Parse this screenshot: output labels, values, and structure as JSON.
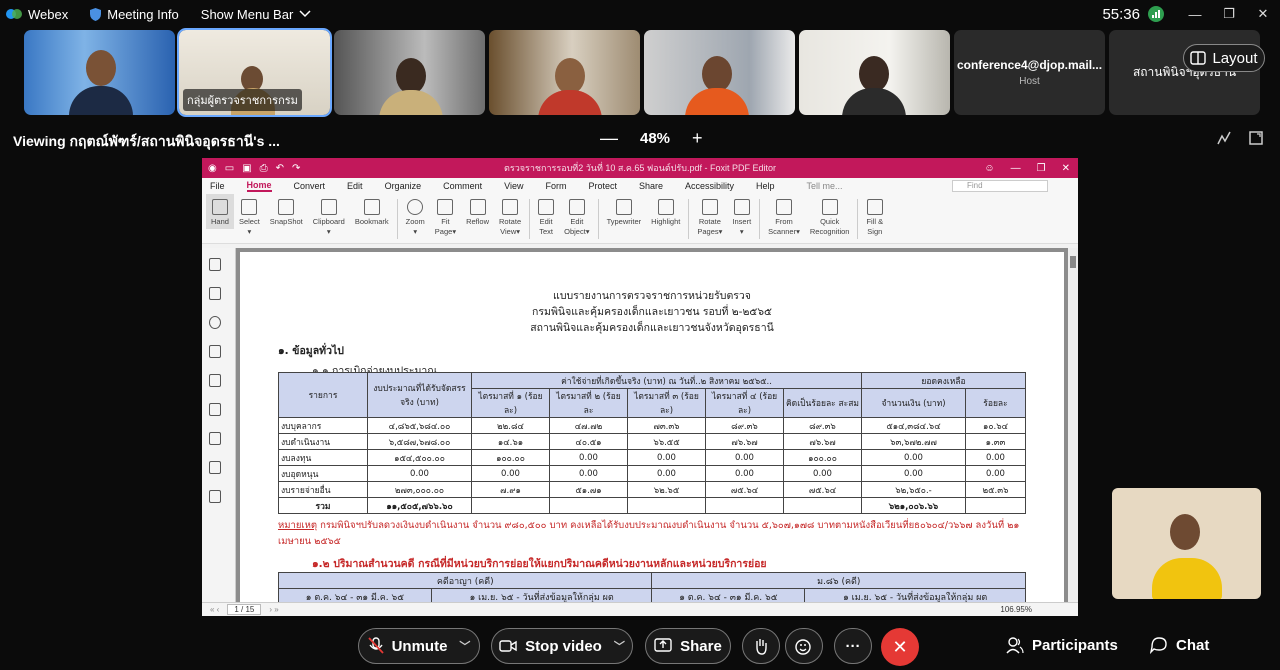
{
  "topbar": {
    "app_name": "Webex",
    "meeting_info": "Meeting Info",
    "show_menu": "Show Menu Bar",
    "timer": "55:36",
    "win_min": "—",
    "win_max": "❐",
    "win_close": "✕"
  },
  "participants_strip": {
    "tile2_label": "กลุ่มผู้ตรวจราชการกรม",
    "tile7_name": "conference4@djop.mail...",
    "tile7_role": "Host",
    "tile8_name": "สถานพินิจฯอุดรธานี"
  },
  "layout_label": "Layout",
  "viewing": {
    "text": "Viewing กฤตณ์พัฑร์/สถานพินิจอุดรธานี's ...",
    "zoom_level": "48%",
    "zoom_out": "—",
    "zoom_in": "+"
  },
  "foxit": {
    "title": "ตรวจราชการรอบที่2 วันที่ 10 ส.ค.65 ฟอนต์ปรับ.pdf - Foxit PDF Editor",
    "menu": [
      "File",
      "Home",
      "Convert",
      "Edit",
      "Organize",
      "Comment",
      "View",
      "Form",
      "Protect",
      "Share",
      "Accessibility",
      "Help"
    ],
    "tell_me": "Tell me...",
    "find": "Find",
    "ribbon": [
      {
        "l1": "Hand",
        "l2": ""
      },
      {
        "l1": "Select",
        "l2": "▾"
      },
      {
        "l1": "SnapShot",
        "l2": ""
      },
      {
        "l1": "Clipboard",
        "l2": "▾"
      },
      {
        "l1": "Bookmark",
        "l2": ""
      },
      {
        "l1": "Zoom",
        "l2": "▾"
      },
      {
        "l1": "Fit",
        "l2": "Page▾"
      },
      {
        "l1": "Reflow",
        "l2": ""
      },
      {
        "l1": "Rotate",
        "l2": "View▾"
      },
      {
        "l1": "Edit",
        "l2": "Text"
      },
      {
        "l1": "Edit",
        "l2": "Object▾"
      },
      {
        "l1": "Typewriter",
        "l2": ""
      },
      {
        "l1": "Highlight",
        "l2": ""
      },
      {
        "l1": "Rotate",
        "l2": "Pages▾"
      },
      {
        "l1": "Insert",
        "l2": "▾"
      },
      {
        "l1": "From",
        "l2": "Scanner▾"
      },
      {
        "l1": "Quick",
        "l2": "Recognition"
      },
      {
        "l1": "Fill &",
        "l2": "Sign"
      }
    ],
    "page_indicator": "1 / 15",
    "zoom": "106.95%"
  },
  "document": {
    "title1": "แบบรายงานการตรวจราชการหน่วยรับตรวจ",
    "title2": "กรมพินิจและคุ้มครองเด็กและเยาวชน รอบที่ ๒-๒๕๖๕",
    "title3": "สถานพินิจและคุ้มครองเด็กและเยาวชนจังหวัดอุดรธานี",
    "section1": "๑. ข้อมูลทั่วไป",
    "section1_1": "๑.๑ การเบิกจ่ายงบประมาณ",
    "table": {
      "h_item": "รายการ",
      "h_budget": "งบประมาณที่ได้รับจัดสรรจริง (บาท)",
      "h_spent": "ค่าใช้จ่ายที่เกิดขึ้นจริง (บาท) ณ วันที่..๒ สิงหาคม ๒๕๖๕..",
      "h_remain": "ยอดคงเหลือ",
      "h_q1": "ไตรมาสที่ ๑ (ร้อยละ)",
      "h_q2": "ไตรมาสที่ ๒ (ร้อยละ",
      "h_q3": "ไตรมาสที่ ๓ (ร้อยละ)",
      "h_q4": "ไตรมาสที่ ๔ (ร้อยละ)",
      "h_cum": "คิดเป็นร้อยละ สะสม",
      "h_amount": "จำนวนเงิน (บาท)",
      "h_pct": "ร้อยละ",
      "rows": [
        {
          "item": "งบบุคลากร",
          "budget": "๔,๘๖๕,๖๘๔.๐๐",
          "q1": "๒๒.๘๔",
          "q2": "๔๗.๗๒",
          "q3": "๗๓.๓๖",
          "q4": "๘๙.๓๖",
          "cum": "๘๙.๓๖",
          "amount": "๕๑๔,๓๘๔.๖๔",
          "pct": "๑๐.๖๔"
        },
        {
          "item": "งบดำเนินงาน",
          "budget": "๖,๕๘๗,๖๗๘.๐๐",
          "q1": "๑๔.๖๑",
          "q2": "๔๐.๕๑",
          "q3": "๖๖.๕๕",
          "q4": "๗๖.๖๗",
          "cum": "๗๖.๖๗",
          "amount": "๖๓,๖๗๒.๗๗",
          "pct": "๑.๓๓"
        },
        {
          "item": "งบลงทุน",
          "budget": "๑๕๔,๕๐๐.๐๐",
          "q1": "๑๐๐.๐๐",
          "q2": "0.00",
          "q3": "0.00",
          "q4": "0.00",
          "cum": "๑๐๐.๐๐",
          "amount": "0.00",
          "pct": "0.00"
        },
        {
          "item": "งบอุดหนุน",
          "budget": "0.00",
          "q1": "0.00",
          "q2": "0.00",
          "q3": "0.00",
          "q4": "0.00",
          "cum": "0.00",
          "amount": "0.00",
          "pct": "0.00"
        },
        {
          "item": "งบรายจ่ายอื่น",
          "budget": "๒๗๓,๐๐๐.๐๐",
          "q1": "๗.๙๑",
          "q2": "๕๑.๗๑",
          "q3": "๖๒.๖๕",
          "q4": "๗๕.๖๔",
          "cum": "๗๕.๖๔",
          "amount": "๖๒,๖๕๐.-",
          "pct": "๒๕.๓๖"
        }
      ],
      "total_label": "รวม",
      "total_budget": "๑๑,๕๐๕,๗๖๖.๖๐",
      "total_amount": "๖๒๑,๐๐๖.๖๖"
    },
    "note_label": "หมายเหตุ",
    "note_text": " กรมพินิจฯปรับลดวงเงินงบดำเนินงาน จำนวน ๙๘๐,๕๐๐ บาท คงเหลือได้รับงบประมาณงบดำเนินงาน จำนวน ๕,๖๐๗,๑๗๘ บาทตามหนังสือเวียนที่ยธ๐๖๐๔/ว๖๖๗ ลงวันที่ ๒๑ เมษายน ๒๕๖๕",
    "section1_2": "๑.๒ ปริมาณสำนวนคดี กรณีที่มีหน่วยบริการย่อยให้แยกปริมาณคดีหน่วยงานหลักและหน่วยบริการย่อย",
    "case_h1": "คดีอาญา (คดี)",
    "case_h2": "ม.๘๖ (คดี)",
    "case_sub1": "๑ ต.ค. ๖๔ - ๓๑ มี.ค. ๖๕",
    "case_sub2": "๑ เม.ย. ๖๕ - วันที่ส่งข้อมูลให้กลุ่ม ผต",
    "case_sub3": "๑ ต.ค. ๖๔ - ๓๑ มี.ค. ๖๕",
    "case_sub4": "๑ เม.ย. ๖๕ - วันที่ส่งข้อมูลให้กลุ่ม ผต"
  },
  "controls": {
    "unmute": "Unmute",
    "stop_video": "Stop video",
    "share": "Share",
    "participants": "Participants",
    "chat": "Chat"
  },
  "colors": {
    "foxit_brand": "#c2185b",
    "end_call": "#e53935",
    "active_tile": "#6aa8ff"
  }
}
